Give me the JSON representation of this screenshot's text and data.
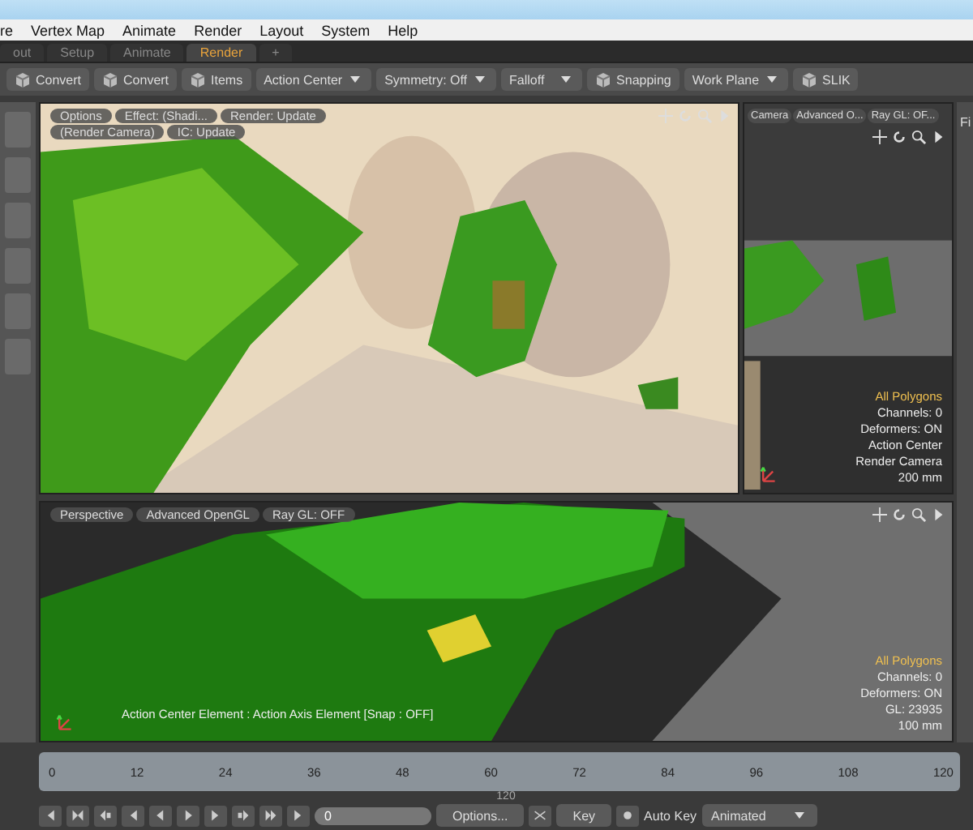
{
  "menu": [
    "re",
    "Vertex Map",
    "Animate",
    "Render",
    "Layout",
    "System",
    "Help"
  ],
  "tabs": [
    {
      "label": "out",
      "selected": false
    },
    {
      "label": "Setup",
      "selected": false
    },
    {
      "label": "Animate",
      "selected": false
    },
    {
      "label": "Render",
      "selected": true
    },
    {
      "label": "+",
      "selected": false
    }
  ],
  "toolbar": [
    {
      "kind": "icon",
      "label": "Convert"
    },
    {
      "kind": "icon",
      "label": "Convert"
    },
    {
      "kind": "icon",
      "label": "Items"
    },
    {
      "kind": "dropdown",
      "label": "Action Center"
    },
    {
      "kind": "dropdown",
      "label": "Symmetry: Off"
    },
    {
      "kind": "dropdown",
      "label": "Falloff"
    },
    {
      "kind": "icon",
      "label": "Snapping"
    },
    {
      "kind": "dropdown",
      "label": "Work Plane"
    },
    {
      "kind": "icon",
      "label": "SLIK"
    }
  ],
  "render_view": {
    "buttons": [
      [
        "Options",
        "Effect: (Shadi...",
        "Render: Update"
      ],
      [
        "(Render Camera)",
        "IC: Update"
      ]
    ]
  },
  "camera_view": {
    "buttons": [
      "Camera",
      "Advanced O...",
      "Ray GL: OF..."
    ],
    "info": [
      "All Polygons",
      "Channels: 0",
      "Deformers: ON",
      "Action Center",
      "Render Camera",
      "200 mm"
    ]
  },
  "side_label": "Fi",
  "perspective_view": {
    "buttons": [
      "Perspective",
      "Advanced OpenGL",
      "Ray GL: OFF"
    ],
    "status": "Action Center Element : Action Axis Element  [Snap : OFF]",
    "info": [
      "All Polygons",
      "Channels: 0",
      "Deformers: ON",
      "GL: 23935",
      "100 mm"
    ]
  },
  "timeline": {
    "ticks": [
      "0",
      "12",
      "24",
      "36",
      "48",
      "60",
      "72",
      "84",
      "96",
      "108",
      "120"
    ],
    "end": "120"
  },
  "transport": {
    "frame": "0",
    "options": "Options...",
    "key": "Key",
    "auto_key": "Auto Key",
    "mode": "Animated"
  }
}
